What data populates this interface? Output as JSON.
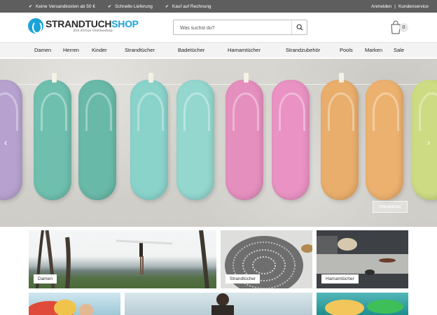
{
  "topbar": {
    "usps": [
      "Keine Versandkosten ab 50 €",
      "Schnelle Lieferung",
      "Kauf auf Rechnung"
    ],
    "login": "Anmelden",
    "separator": "|",
    "service": "Kundenservice"
  },
  "header": {
    "logo_prefix": "STRANDTUCH",
    "logo_suffix": "SHOP",
    "logo_tagline": "Ein Etrias Onlineshop",
    "search_placeholder": "Was suchst du?",
    "cart_count": "0"
  },
  "nav": {
    "items": [
      "Damen",
      "Herren",
      "Kinder",
      "Strandtücher",
      "Badetücher",
      "Hamamtücher",
      "Strandzubehör",
      "Pools",
      "Marken",
      "Sale"
    ]
  },
  "hero": {
    "button_label": "Havaianas",
    "prev_arrow": "‹",
    "next_arrow": "›"
  },
  "categories": [
    {
      "label": "Damen"
    },
    {
      "label": "Strandtücher"
    },
    {
      "label": "Hamamtücher"
    }
  ]
}
